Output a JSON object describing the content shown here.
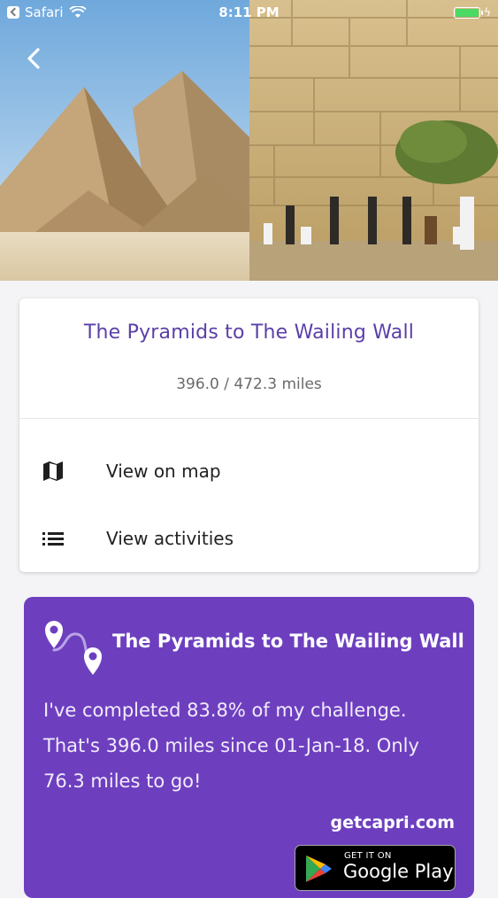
{
  "status_bar": {
    "back_app": "Safari",
    "time": "8:11 PM",
    "battery_level": 1.0,
    "battery_color": "#4cd964"
  },
  "nav": {
    "back_icon": "chevron-left-icon"
  },
  "challenge": {
    "title": "The Pyramids to The Wailing Wall",
    "distance": "396.0 / 472.3 miles"
  },
  "menu": {
    "items": [
      {
        "label": "View on map",
        "icon": "map-icon"
      },
      {
        "label": "View activities",
        "icon": "list-icon"
      }
    ]
  },
  "share": {
    "title": "The Pyramids to The Wailing Wall",
    "message": "I've completed 83.8% of my challenge. That's 396.0 miles since 01-Jan-18. Only 76.3 miles to go!",
    "site": "getcapri.com",
    "store_badge_small": "GET IT ON",
    "store_badge_big": "Google Play",
    "background_color": "#6d3fbf"
  },
  "colors": {
    "accent": "#5b3fa8",
    "share_bg": "#6d3fbf",
    "page_bg": "#f4f4f6"
  }
}
